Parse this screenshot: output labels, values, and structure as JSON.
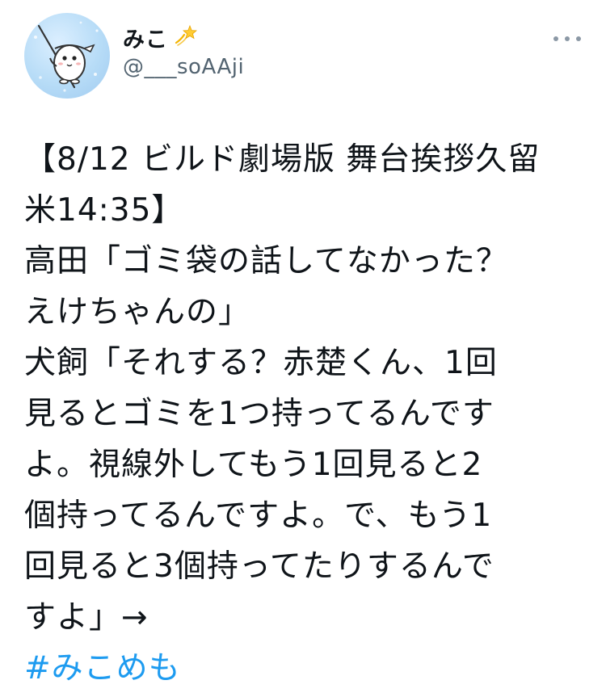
{
  "author": {
    "display_name": "みこ",
    "name_emoji": "dizzy-star-icon",
    "handle": "@___soAAji",
    "avatar_icon": "character-avatar-icon"
  },
  "more_icon": "more-dots-icon",
  "tweet": {
    "lines": [
      "【8/12 ビルド劇場版 舞台挨拶久留",
      "米14:35】",
      "高田「ゴミ袋の話してなかった？",
      "えけちゃんの」",
      "犬飼「それする？赤楚くん、1回",
      "見るとゴミを1つ持ってるんです",
      "よ。視線外してもう1回見ると2",
      "個持ってるんですよ。で、もう1",
      "回見ると3個持ってたりするんで",
      "すよ」→"
    ],
    "hashtag": "#みこめも"
  },
  "colors": {
    "text": "#0f1419",
    "secondary": "#536471",
    "link": "#1d9bf0",
    "background": "#ffffff"
  }
}
